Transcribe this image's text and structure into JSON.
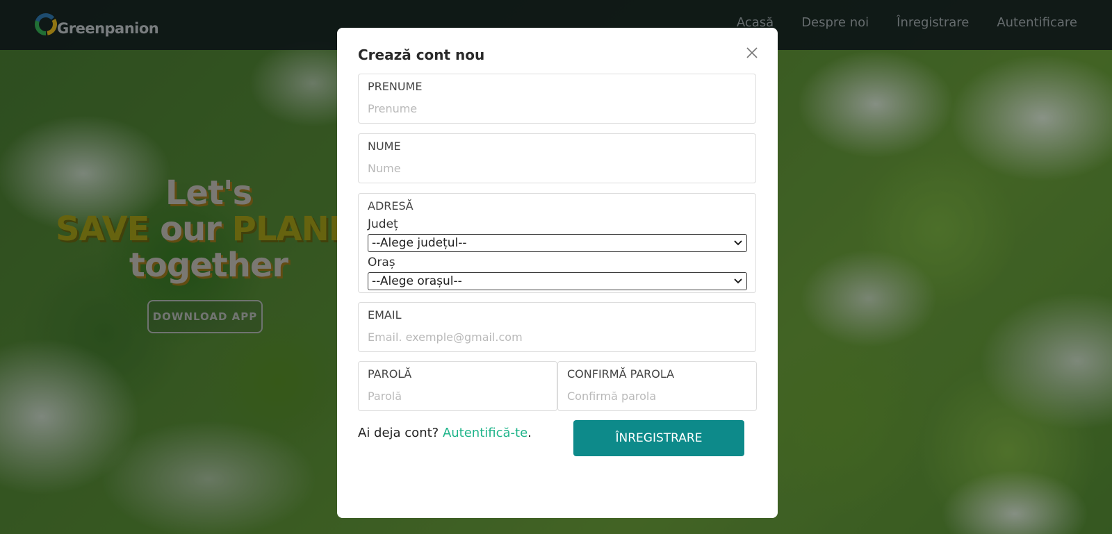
{
  "brand": {
    "name": "Greenpanion"
  },
  "nav": {
    "items": [
      {
        "label": "Acasă"
      },
      {
        "label": "Despre noi"
      },
      {
        "label": "Înregistrare"
      },
      {
        "label": "Autentificare"
      }
    ]
  },
  "hero": {
    "line1": "Let's",
    "line2_part1": "SAVE",
    "line2_part2": " our ",
    "line2_part3": "PLANET",
    "line3": "together",
    "download_button": "DOWNLOAD APP"
  },
  "modal": {
    "title": "Crează cont nou",
    "prenume": {
      "label": "PRENUME",
      "placeholder": "Prenume",
      "value": ""
    },
    "nume": {
      "label": "NUME",
      "placeholder": "Nume",
      "value": ""
    },
    "adresa": {
      "label": "ADRESĂ",
      "judet_label": "Județ",
      "judet_selected": "--Alege județul--",
      "oras_label": "Oraș",
      "oras_selected": "--Alege orașul--"
    },
    "email": {
      "label": "EMAIL",
      "placeholder": "Email. exemple@gmail.com",
      "value": ""
    },
    "parola": {
      "label": "PAROLĂ",
      "placeholder": "Parolă",
      "value": ""
    },
    "confirma": {
      "label": "CONFIRMĂ PAROLA",
      "placeholder": "Confirmă parola",
      "value": ""
    },
    "login_prompt": "Ai deja cont? ",
    "login_link": "Autentifică-te",
    "login_suffix": ".",
    "submit_label": "ÎNREGISTRARE"
  },
  "colors": {
    "accent": "#0d8a8a",
    "link": "#1fb48a",
    "navbar": "#121c1e",
    "hero_yellow": "#8e8a16"
  }
}
